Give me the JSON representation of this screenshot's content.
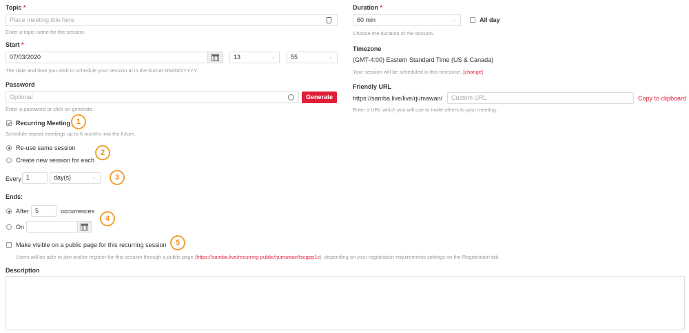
{
  "topic": {
    "label": "Topic",
    "required": "*",
    "placeholder": "Place meeting title here",
    "help": "Enter a topic name for the session."
  },
  "start": {
    "label": "Start",
    "required": "*",
    "date": "07/03/2020",
    "hour": "13",
    "minute": "55",
    "help": "The date and time you wish to schedule your session at in the format MM/DD/YYYY."
  },
  "password": {
    "label": "Password",
    "placeholder": "Optional",
    "generate_label": "Generate",
    "help": "Enter a password or click on generate."
  },
  "recurring": {
    "label": "Recurring Meeting",
    "checked": true,
    "help": "Schedule repeat meetings up to 6 months into the future."
  },
  "session_mode": {
    "options": [
      "Re-use same session",
      "Create new session for each"
    ],
    "selected": 0
  },
  "every": {
    "label": "Every",
    "value": "1",
    "unit": "day(s)"
  },
  "ends": {
    "label": "Ends:",
    "after_label": "After",
    "after_value": "5",
    "occurrences_label": "occurrences",
    "on_label": "On",
    "selected": "after"
  },
  "public_page": {
    "label": "Make visible on a public page for this recurring session",
    "help_prefix": "Users will be able to join and/or register for this session through a public page (",
    "help_link": "https://samba.live/recurring-public/rjumawan/tscgpp1c",
    "help_suffix": "), depending on your registration requirements settings on the Registration tab."
  },
  "description": {
    "label": "Description"
  },
  "duration": {
    "label": "Duration",
    "required": "*",
    "value": "60 min",
    "allday_label": "All day",
    "help": "Choose the duration of the session."
  },
  "timezone": {
    "label": "Timezone",
    "value": "(GMT-4:00) Eastern Standard Time (US & Canada)",
    "help_prefix": "Your session will be scheduled in this timezone. ",
    "change_label": "[change]"
  },
  "friendly_url": {
    "label": "Friendly URL",
    "prefix": "https://samba.live/live/rjumawan/",
    "placeholder": "Custom URL",
    "copy_label": "Copy to clipboard",
    "help": "Enter a URL which you will use to invite others to your meeting."
  },
  "badges": [
    "1",
    "2",
    "3",
    "4",
    "5"
  ],
  "colors": {
    "accent": "#e01e38",
    "badge": "#f08c1e"
  },
  "icons": {
    "dropdown": "chevron-down-icon",
    "calendar": "calendar-icon",
    "key": "password-key-icon",
    "eye": "reveal-icon"
  }
}
